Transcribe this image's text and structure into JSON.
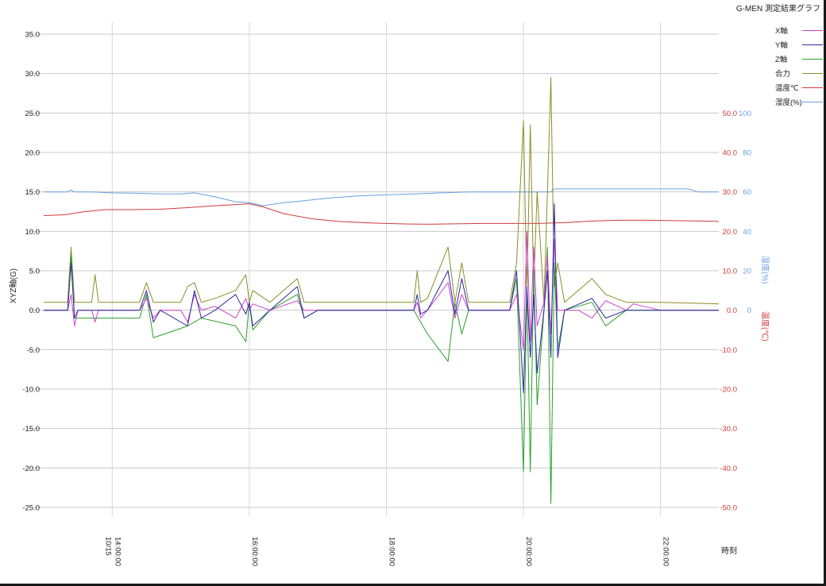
{
  "title": "G-MEN 測定結果グラフ",
  "chart_data": {
    "type": "line",
    "title": "G-MEN 測定結果グラフ",
    "xlabel": "時刻",
    "ylabel": "XYZ軸(G)",
    "y2label": "温度(℃)",
    "y3label": "湿度(%)",
    "x_start_label": "10/15",
    "x_tick_labels": [
      "14:00:00",
      "16:00:00",
      "18:00:00",
      "20:00:00",
      "22:00:00"
    ],
    "x_ticks_hours": [
      14,
      16,
      18,
      20,
      22
    ],
    "xlim_hours": [
      13.0,
      22.85
    ],
    "ylim": [
      -25,
      35
    ],
    "y_ticks": [
      -25,
      -20,
      -15,
      -10,
      -5,
      0,
      5,
      10,
      15,
      20,
      25,
      30,
      35
    ],
    "y_tick_labels": [
      "-25.0",
      "-20.0",
      "-15.0",
      "-10.0",
      "-5.0",
      "0.0",
      "5.0",
      "10.0",
      "15.0",
      "20.0",
      "25.0",
      "30.0",
      "35.0"
    ],
    "y2_ticks": [
      -50,
      -40,
      -30,
      -20,
      -10,
      0,
      10,
      20,
      30,
      40,
      50
    ],
    "y2_tick_labels": [
      "-50.0",
      "-40.0",
      "-30.0",
      "-20.0",
      "-10.0",
      "0.0",
      "10.0",
      "20.0",
      "30.0",
      "40.0",
      "50.0"
    ],
    "y3_ticks": [
      0,
      20,
      40,
      60,
      80,
      100
    ],
    "y3_tick_labels": [
      "0",
      "20",
      "40",
      "60",
      "80",
      "100"
    ],
    "grid": true,
    "legend_position": "top-right",
    "series": [
      {
        "name": "X軸",
        "axis": "y",
        "color": "#d040c8",
        "x": [
          13.0,
          13.35,
          13.4,
          13.45,
          13.5,
          13.7,
          13.75,
          13.8,
          14.0,
          14.4,
          14.5,
          14.6,
          14.7,
          15.0,
          15.1,
          15.2,
          15.3,
          15.5,
          15.8,
          15.95,
          16.0,
          16.05,
          16.3,
          16.7,
          16.8,
          17.0,
          18.0,
          18.4,
          18.45,
          18.5,
          18.6,
          18.9,
          19.0,
          19.1,
          19.2,
          19.5,
          19.8,
          19.9,
          20.0,
          20.05,
          20.1,
          20.15,
          20.2,
          20.3,
          20.35,
          20.4,
          20.45,
          20.5,
          20.6,
          20.8,
          21.0,
          21.2,
          21.5,
          21.6,
          22.0,
          22.85
        ],
        "y": [
          0,
          0,
          2,
          -2,
          0,
          0,
          -1.5,
          0,
          0,
          0,
          1.5,
          -1,
          0,
          0,
          -1.5,
          2,
          0,
          0.5,
          -1,
          1.5,
          0,
          0.8,
          0,
          1.2,
          0,
          0,
          0,
          0,
          1,
          -1,
          0,
          3.5,
          -1,
          2,
          0,
          0,
          0,
          2,
          -5,
          10,
          -4,
          8,
          -2,
          1,
          7,
          -3,
          9,
          0,
          0,
          0,
          -1,
          1.2,
          0,
          0.8,
          0,
          0
        ]
      },
      {
        "name": "Y軸",
        "axis": "y",
        "color": "#2a2aa0",
        "x": [
          13.0,
          13.35,
          13.4,
          13.45,
          13.5,
          14.4,
          14.5,
          14.6,
          14.7,
          15.1,
          15.2,
          15.3,
          15.5,
          15.8,
          15.95,
          16.0,
          16.05,
          16.3,
          16.7,
          16.8,
          17.0,
          18.4,
          18.45,
          18.5,
          18.6,
          18.9,
          19.0,
          19.1,
          19.2,
          19.5,
          19.8,
          19.9,
          20.0,
          20.05,
          20.1,
          20.15,
          20.2,
          20.3,
          20.35,
          20.4,
          20.45,
          20.5,
          20.6,
          21.0,
          21.2,
          21.5,
          22.85
        ],
        "y": [
          0,
          0,
          6,
          -1,
          0,
          0,
          2.5,
          -1.5,
          0,
          -2,
          2.5,
          -1,
          0,
          2,
          -0.5,
          1,
          -2,
          0,
          3,
          -1,
          0,
          0,
          2,
          -0.5,
          0,
          5,
          -0.5,
          4,
          0,
          0,
          0,
          5,
          -10.5,
          3,
          -6,
          2,
          -8,
          0,
          5,
          -6,
          13.5,
          -6,
          0,
          1.5,
          -1,
          0,
          0
        ]
      },
      {
        "name": "Z軸",
        "axis": "y",
        "color": "#2aa02a",
        "x": [
          13.0,
          13.35,
          13.4,
          13.45,
          13.5,
          13.8,
          14.0,
          14.4,
          14.5,
          14.6,
          15.1,
          15.3,
          15.8,
          15.95,
          16.0,
          16.05,
          16.3,
          16.7,
          16.8,
          17.0,
          18.0,
          18.4,
          18.6,
          18.9,
          19.0,
          19.1,
          19.2,
          19.5,
          19.8,
          19.9,
          20.0,
          20.05,
          20.1,
          20.15,
          20.2,
          20.3,
          20.35,
          20.4,
          20.45,
          20.5,
          20.6,
          21.0,
          21.2,
          21.5,
          22.85
        ],
        "y": [
          0,
          0,
          7,
          -1,
          -1,
          -1,
          -1,
          -1,
          2,
          -3.5,
          -2,
          -1,
          -2,
          -4,
          1,
          -2.5,
          0,
          2,
          -1,
          0,
          0,
          0,
          -3,
          -6.5,
          1,
          -3,
          0,
          0,
          0,
          4,
          -20.5,
          3,
          -20.5,
          5,
          -12,
          0,
          8,
          -24.5,
          6,
          -5,
          0,
          1,
          -2,
          0,
          0
        ]
      },
      {
        "name": "合力",
        "axis": "y",
        "color": "#8c8c2a",
        "x": [
          13.0,
          13.35,
          13.4,
          13.45,
          13.5,
          13.7,
          13.75,
          13.8,
          14.0,
          14.4,
          14.5,
          14.6,
          14.7,
          15.0,
          15.1,
          15.2,
          15.3,
          15.5,
          15.8,
          15.95,
          16.0,
          16.05,
          16.3,
          16.7,
          16.8,
          17.0,
          18.0,
          18.4,
          18.45,
          18.5,
          18.6,
          18.9,
          19.0,
          19.1,
          19.2,
          19.5,
          19.8,
          19.9,
          20.0,
          20.05,
          20.1,
          20.15,
          20.2,
          20.3,
          20.35,
          20.4,
          20.45,
          20.5,
          20.6,
          21.0,
          21.2,
          21.5,
          22.0,
          22.85
        ],
        "y": [
          1,
          1,
          8,
          1,
          1,
          1,
          4.5,
          1,
          1,
          1,
          3.5,
          1,
          1,
          1,
          3,
          3.5,
          1,
          1.5,
          2.5,
          4.5,
          1,
          2.5,
          1,
          4,
          1,
          1,
          1,
          1,
          5,
          1,
          1.5,
          8,
          1,
          6,
          1,
          1,
          1,
          6,
          24,
          2,
          23.5,
          3,
          15,
          1,
          15,
          29.5,
          3,
          6,
          1,
          4,
          2,
          1,
          1,
          0.8
        ]
      },
      {
        "name": "温度℃",
        "axis": "y2",
        "color": "#d03a3a",
        "x": [
          13.0,
          13.3,
          13.6,
          13.9,
          14.3,
          14.7,
          15.1,
          15.5,
          15.8,
          16.0,
          16.2,
          16.5,
          16.9,
          17.3,
          17.8,
          18.2,
          18.6,
          19.0,
          19.4,
          19.8,
          20.2,
          20.6,
          21.0,
          21.4,
          21.8,
          22.2,
          22.6,
          22.85
        ],
        "y": [
          24,
          24.2,
          25,
          25.5,
          25.5,
          25.6,
          26,
          26.5,
          26.8,
          27,
          26.2,
          24.5,
          23.2,
          22.5,
          22.1,
          21.9,
          21.8,
          21.9,
          22,
          22,
          22,
          22.2,
          22.6,
          22.8,
          22.8,
          22.7,
          22.6,
          22.5
        ]
      },
      {
        "name": "湿度(%)",
        "axis": "y3",
        "color": "#6aa0e0",
        "x": [
          13.0,
          13.35,
          13.4,
          13.45,
          13.7,
          14.0,
          14.4,
          14.7,
          15.0,
          15.2,
          15.5,
          15.8,
          16.0,
          16.2,
          16.5,
          16.8,
          17.2,
          17.6,
          18.0,
          18.4,
          18.8,
          19.2,
          19.6,
          20.0,
          20.4,
          20.45,
          20.8,
          21.2,
          21.6,
          22.0,
          22.4,
          22.55,
          22.85
        ],
        "y": [
          60,
          60,
          61,
          60,
          60,
          59.5,
          59.3,
          59,
          59,
          59.5,
          57.5,
          55,
          54.5,
          53,
          54.5,
          55.5,
          57,
          58,
          58.5,
          59,
          59.5,
          60,
          60,
          60,
          60,
          61.5,
          61.5,
          61.5,
          61.5,
          61.5,
          61.5,
          60,
          60
        ]
      }
    ]
  }
}
